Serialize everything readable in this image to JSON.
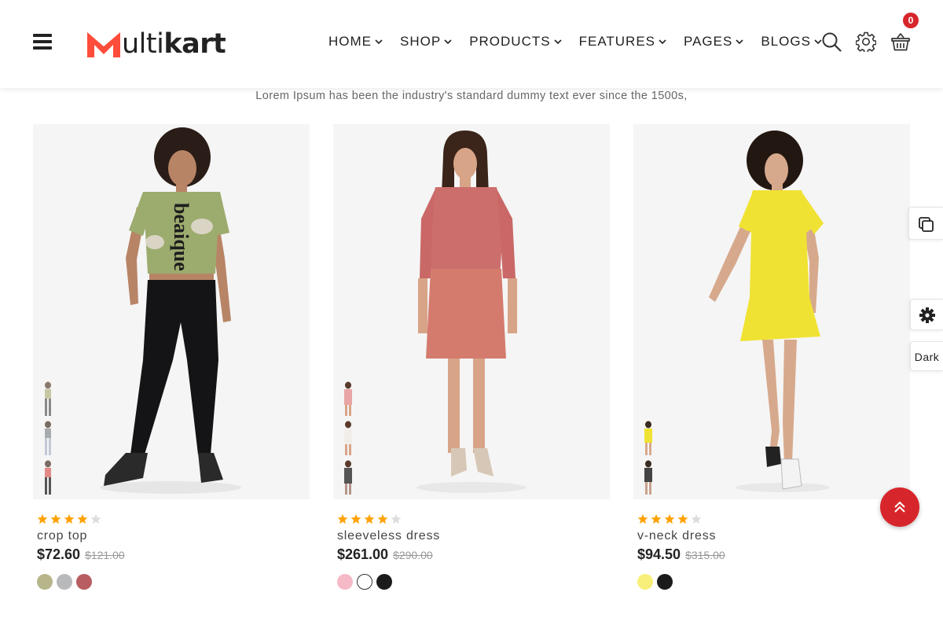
{
  "header": {
    "logo_text_light": "ulti",
    "logo_text_bold": "kart",
    "brand_color": "#ff4c3b",
    "nav": [
      {
        "label": "HOME"
      },
      {
        "label": "SHOP"
      },
      {
        "label": "PRODUCTS"
      },
      {
        "label": "FEATURES"
      },
      {
        "label": "PAGES"
      },
      {
        "label": "BLOGS"
      }
    ],
    "cart_count": "0"
  },
  "tagline": "Lorem Ipsum has been the industry's standard dummy text ever since the 1500s,",
  "products": [
    {
      "name": "crop top",
      "price": "$72.60",
      "old_price": "$121.00",
      "rating": 4,
      "rating_max": 5,
      "swatches": [
        "#b7b68b",
        "#b8b9bb",
        "#b85d62"
      ]
    },
    {
      "name": "sleeveless dress",
      "price": "$261.00",
      "old_price": "$290.00",
      "rating": 4,
      "rating_max": 5,
      "swatches": [
        "#f6b9c6",
        "#ffffff",
        "#1b1b1b"
      ]
    },
    {
      "name": "v-neck dress",
      "price": "$94.50",
      "old_price": "$315.00",
      "rating": 4,
      "rating_max": 5,
      "swatches": [
        "#f8ef7a",
        "#1b1b1b"
      ]
    }
  ],
  "side_tools": {
    "dark_label": "Dark"
  },
  "colors": {
    "star_filled": "#ffa200",
    "star_empty": "#dddddd",
    "accent_red": "#d7262b"
  }
}
